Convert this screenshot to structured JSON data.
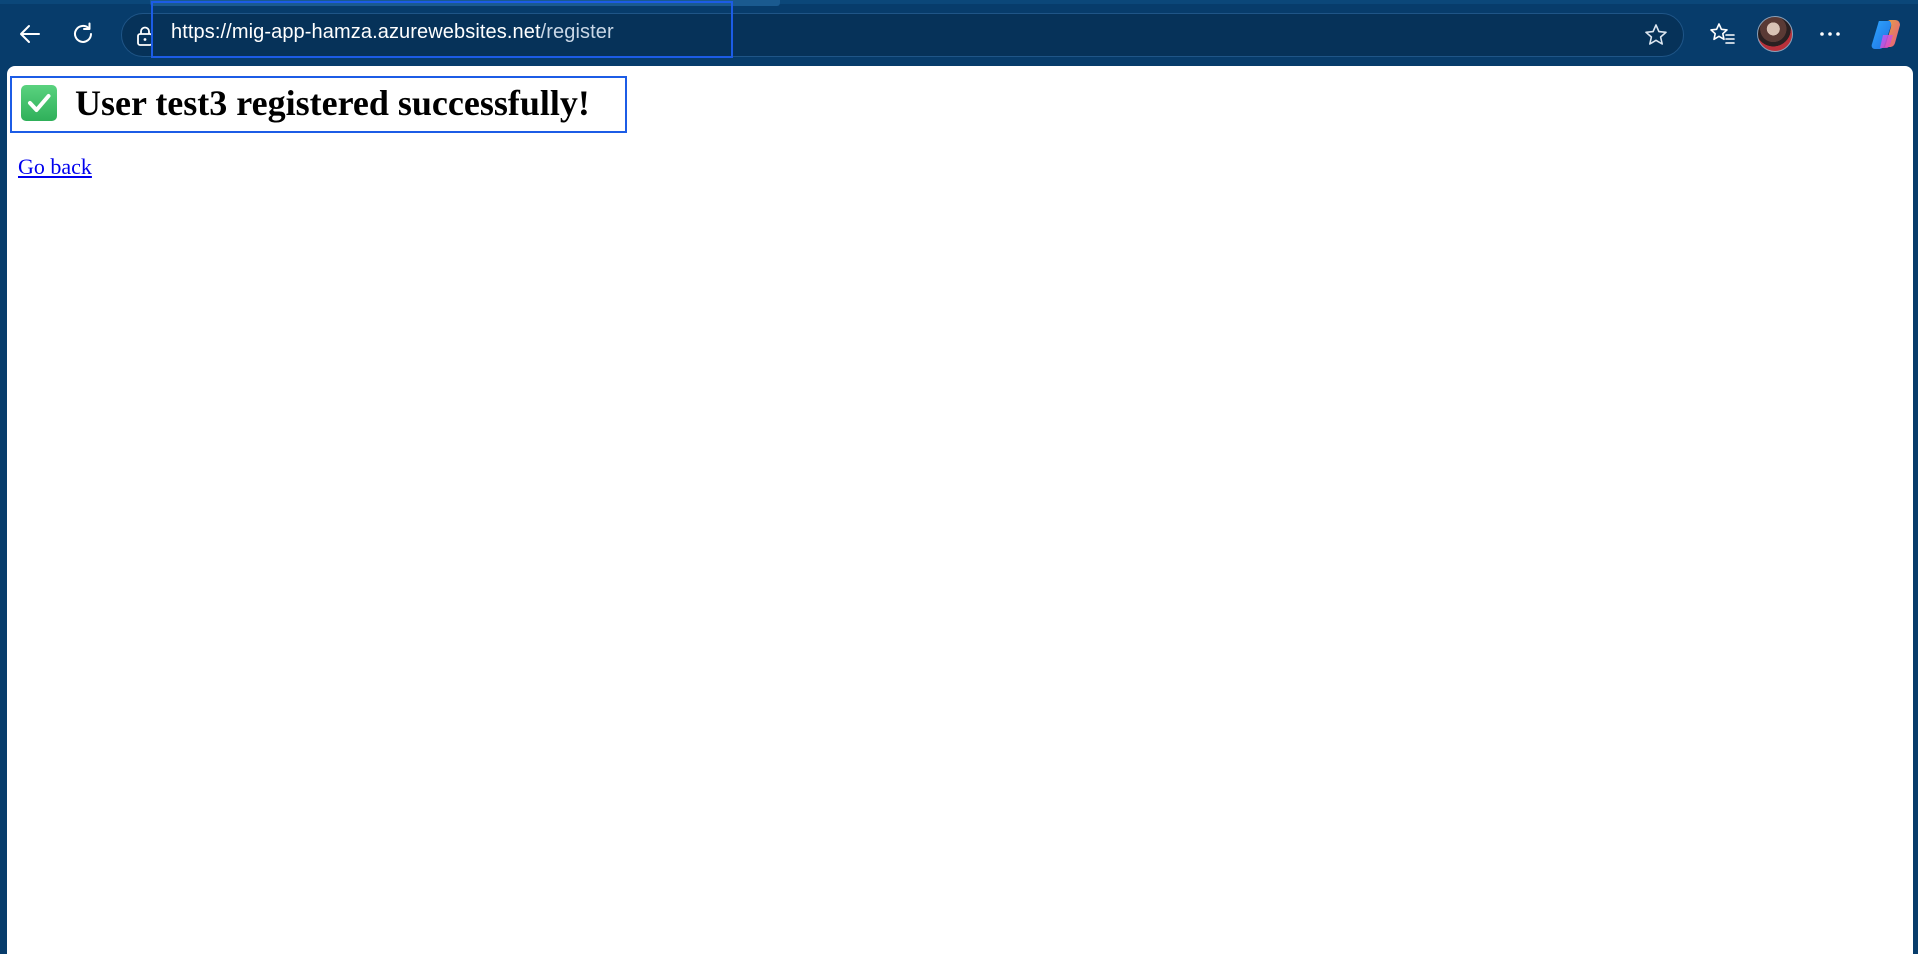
{
  "browser": {
    "url_host": "https://mig-app-hamza.azurewebsites.net",
    "url_path": "/register",
    "icons": {
      "back": "back-arrow-icon",
      "reload": "reload-icon",
      "lock": "lock-icon",
      "star": "star-icon",
      "favorites": "favorites-icon",
      "profile": "profile-avatar",
      "more": "more-icon",
      "copilot": "copilot-icon"
    },
    "colors": {
      "chrome_background": "#073c6b",
      "highlight_border": "#1c5ce6"
    }
  },
  "page": {
    "heading_text": "User test3 registered successfully!",
    "heading_icon": "check-mark-icon",
    "back_link_text": "Go back",
    "colors": {
      "link": "#0000ee",
      "check_icon": "#2fb05a"
    }
  }
}
